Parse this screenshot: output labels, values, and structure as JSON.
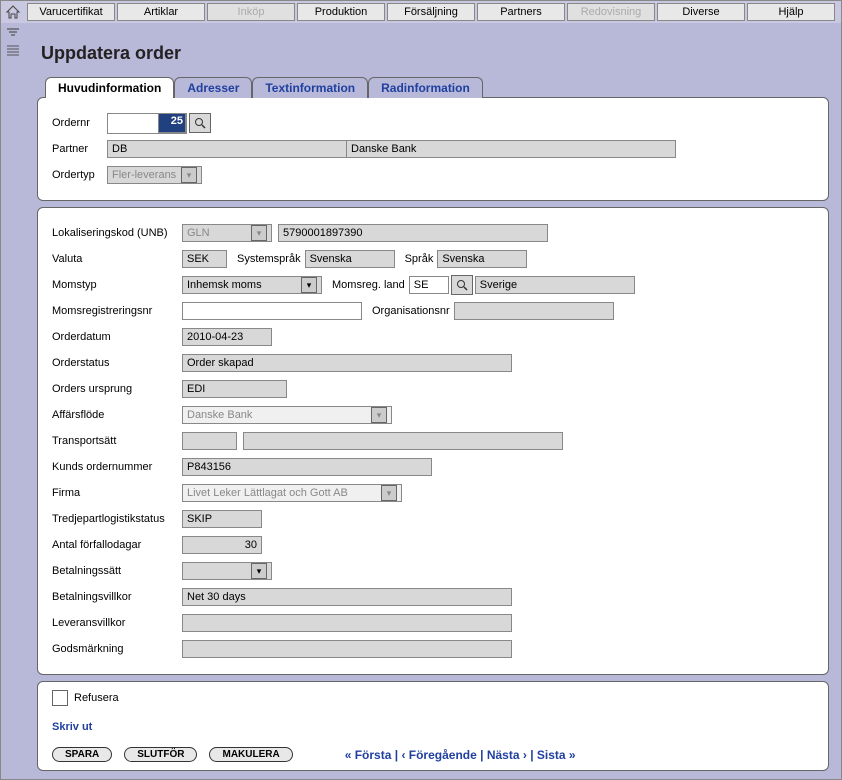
{
  "menu": {
    "items": [
      {
        "label": "Varucertifikat",
        "disabled": false
      },
      {
        "label": "Artiklar",
        "disabled": false
      },
      {
        "label": "Inköp",
        "disabled": true
      },
      {
        "label": "Produktion",
        "disabled": false
      },
      {
        "label": "Försäljning",
        "disabled": false
      },
      {
        "label": "Partners",
        "disabled": false
      },
      {
        "label": "Redovisning",
        "disabled": true
      },
      {
        "label": "Diverse",
        "disabled": false
      },
      {
        "label": "Hjälp",
        "disabled": false
      }
    ]
  },
  "title": "Uppdatera order",
  "tabs": [
    {
      "label": "Huvudinformation",
      "active": true
    },
    {
      "label": "Adresser",
      "active": false
    },
    {
      "label": "Textinformation",
      "active": false
    },
    {
      "label": "Radinformation",
      "active": false
    }
  ],
  "top": {
    "ordernr_label": "Ordernr",
    "ordernr_value": "25",
    "partner_label": "Partner",
    "partner_code": "DB",
    "partner_name": "Danske Bank",
    "ordertyp_label": "Ordertyp",
    "ordertyp_value": "Fler-leverans"
  },
  "main": {
    "lokkod_label": "Lokaliseringskod (UNB)",
    "lokkod_type": "GLN",
    "lokkod_value": "5790001897390",
    "valuta_label": "Valuta",
    "valuta_value": "SEK",
    "systemsprak_label": "Systemspråk",
    "systemsprak_value": "Svenska",
    "sprak_label": "Språk",
    "sprak_value": "Svenska",
    "momstyp_label": "Momstyp",
    "momstyp_value": "Inhemsk moms",
    "momsreg_land_label": "Momsreg. land",
    "momsreg_land_code": "SE",
    "momsreg_land_name": "Sverige",
    "momsregnr_label": "Momsregistreringsnr",
    "momsregnr_value": "",
    "orgnr_label": "Organisationsnr",
    "orgnr_value": "",
    "orderdatum_label": "Orderdatum",
    "orderdatum_value": "2010-04-23",
    "orderstatus_label": "Orderstatus",
    "orderstatus_value": "Order skapad",
    "ursprung_label": "Orders ursprung",
    "ursprung_value": "EDI",
    "affarsflode_label": "Affärsflöde",
    "affarsflode_value": "Danske Bank",
    "transportsatt_label": "Transportsätt",
    "transportsatt_code": "",
    "transportsatt_name": "",
    "kundordernr_label": "Kunds ordernummer",
    "kundordernr_value": "P843156",
    "firma_label": "Firma",
    "firma_value": "Livet Leker Lättlagat och Gott AB",
    "tpl_label": "Tredjepartlogistikstatus",
    "tpl_value": "SKIP",
    "forfallodagar_label": "Antal förfallodagar",
    "forfallodagar_value": "30",
    "betalningssatt_label": "Betalningssätt",
    "betalningssatt_value": "",
    "betalningsvillkor_label": "Betalningsvillkor",
    "betalningsvillkor_value": "Net 30 days",
    "leveransvillkor_label": "Leveransvillkor",
    "leveransvillkor_value": "",
    "godsmarkning_label": "Godsmärkning",
    "godsmarkning_value": ""
  },
  "bottom": {
    "refusera_label": "Refusera",
    "skriv_ut": "Skriv ut",
    "spara": "SPARA",
    "slutfor": "SLUTFÖR",
    "makulera": "MAKULERA",
    "nav_first": "« Första",
    "nav_prev": "‹ Föregående",
    "nav_next": "Nästa ›",
    "nav_last": "Sista »",
    "sep": " | "
  }
}
